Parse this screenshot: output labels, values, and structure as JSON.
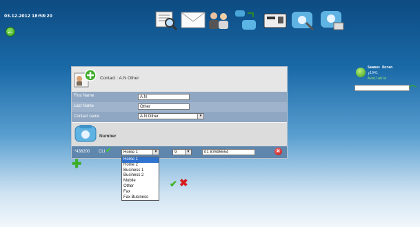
{
  "header": {
    "datetime": "03.12.2012 18:58:20",
    "toolbar": [
      {
        "name": "directory-search-icon"
      },
      {
        "name": "messages-icon"
      },
      {
        "name": "contacts-icon"
      },
      {
        "name": "call-transfer-icon"
      },
      {
        "name": "fax-icon"
      },
      {
        "name": "phone-settings-icon"
      },
      {
        "name": "phone-keypad-icon"
      }
    ]
  },
  "user": {
    "name": "Seamus Doran",
    "extension": "╓1041",
    "status": "Available"
  },
  "contact": {
    "title": "Contact : A.N Other",
    "fields": {
      "first_name_label": "First Name",
      "first_name_value": "A.N",
      "last_name_label": "Last Name",
      "last_name_value": "Other",
      "contact_name_label": "Contact name",
      "contact_name_value": "A.N Other"
    }
  },
  "number": {
    "title": "Number",
    "ext": "*436200",
    "cli_label": "CLI",
    "type_selected": "Home 1",
    "prefix_selected": "9",
    "phone_value": "01 87695554",
    "type_options": [
      "Home 1",
      "Home 2",
      "Business 1",
      "Business 2",
      "Mobile",
      "Other",
      "Fax",
      "Fax Business"
    ]
  }
}
